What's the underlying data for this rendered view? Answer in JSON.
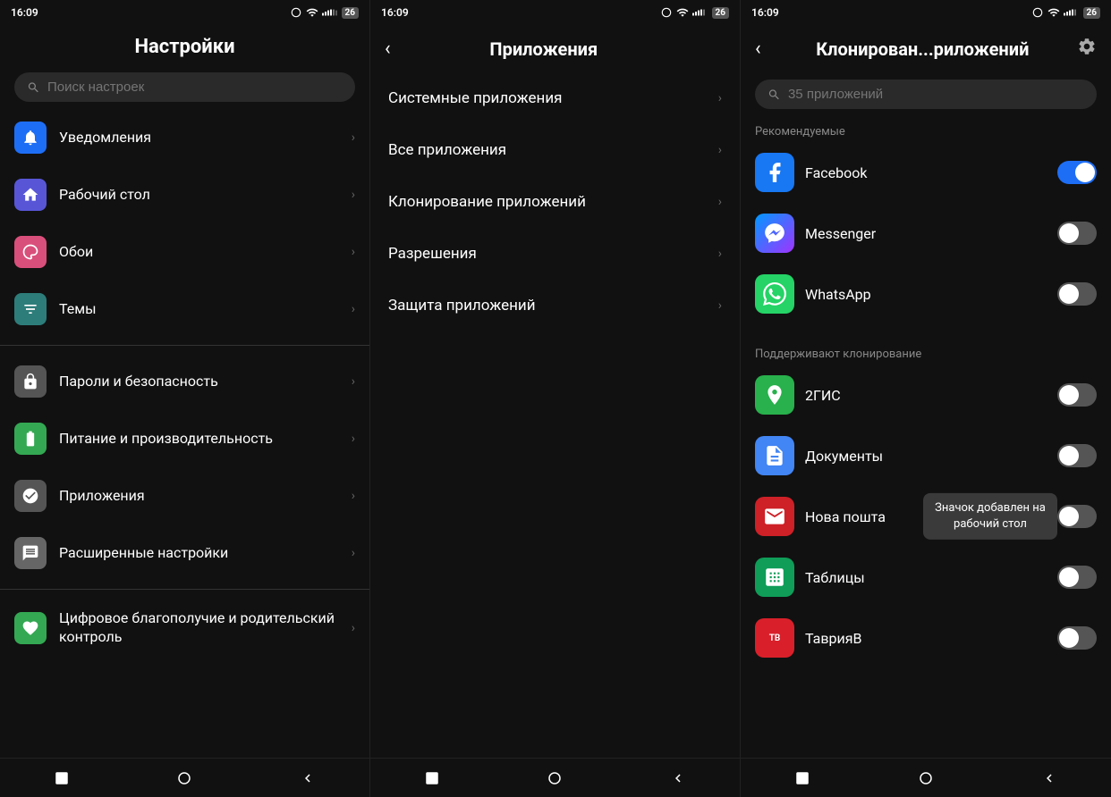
{
  "panels": {
    "left": {
      "title": "Настройки",
      "search_placeholder": "Поиск настроек",
      "items_group1": [
        {
          "id": "notifications",
          "label": "Уведомления",
          "icon_color": "ic-blue",
          "icon": "🔔"
        },
        {
          "id": "desktop",
          "label": "Рабочий стол",
          "icon_color": "ic-indigo",
          "icon": "🏠"
        },
        {
          "id": "wallpaper",
          "label": "Обои",
          "icon_color": "ic-pink",
          "icon": "🌸"
        },
        {
          "id": "themes",
          "label": "Темы",
          "icon_color": "ic-teal",
          "icon": "🖼"
        }
      ],
      "items_group2": [
        {
          "id": "passwords",
          "label": "Пароли и безопасность",
          "icon_color": "ic-gray",
          "icon": "⚙"
        },
        {
          "id": "battery",
          "label": "Питание и производительность",
          "icon_color": "ic-green",
          "icon": "🔋"
        },
        {
          "id": "apps",
          "label": "Приложения",
          "icon_color": "ic-gray",
          "icon": "⚙"
        },
        {
          "id": "advanced",
          "label": "Расширенные настройки",
          "icon_color": "ic-lgray",
          "icon": "💬"
        }
      ],
      "items_group3": [
        {
          "id": "digital",
          "label": "Цифровое благополучие и родительский контроль",
          "icon_color": "ic-green",
          "icon": "💚"
        }
      ]
    },
    "mid": {
      "title": "Приложения",
      "back_label": "‹",
      "items": [
        {
          "id": "system",
          "label": "Системные приложения"
        },
        {
          "id": "all",
          "label": "Все приложения"
        },
        {
          "id": "clone",
          "label": "Клонирование приложений"
        },
        {
          "id": "permissions",
          "label": "Разрешения"
        },
        {
          "id": "protection",
          "label": "Защита приложений"
        }
      ]
    },
    "right": {
      "title": "Клонирован...риложений",
      "back_label": "‹",
      "search_placeholder": "35 приложений",
      "section_recommended": "Рекомендуемые",
      "section_supported": "Поддерживают клонирование",
      "recommended": [
        {
          "id": "facebook",
          "label": "Facebook",
          "enabled": true
        },
        {
          "id": "messenger",
          "label": "Messenger",
          "enabled": false
        },
        {
          "id": "whatsapp",
          "label": "WhatsApp",
          "enabled": false
        }
      ],
      "supported": [
        {
          "id": "2gis",
          "label": "2ГИС",
          "enabled": false
        },
        {
          "id": "docs",
          "label": "Документы",
          "enabled": false
        },
        {
          "id": "nova",
          "label": "Нова пошта",
          "enabled": false,
          "tooltip": "Значок добавлен на рабочий стол"
        },
        {
          "id": "sheets",
          "label": "Таблицы",
          "enabled": false
        },
        {
          "id": "tavria",
          "label": "ТаврияВ",
          "enabled": false
        }
      ]
    }
  },
  "nav": {
    "square_label": "■",
    "circle_label": "●",
    "back_label": "◄"
  },
  "status_bar": {
    "time": "16:09",
    "icons": "🔊 ✦ ◀ 📶 📶 26"
  }
}
